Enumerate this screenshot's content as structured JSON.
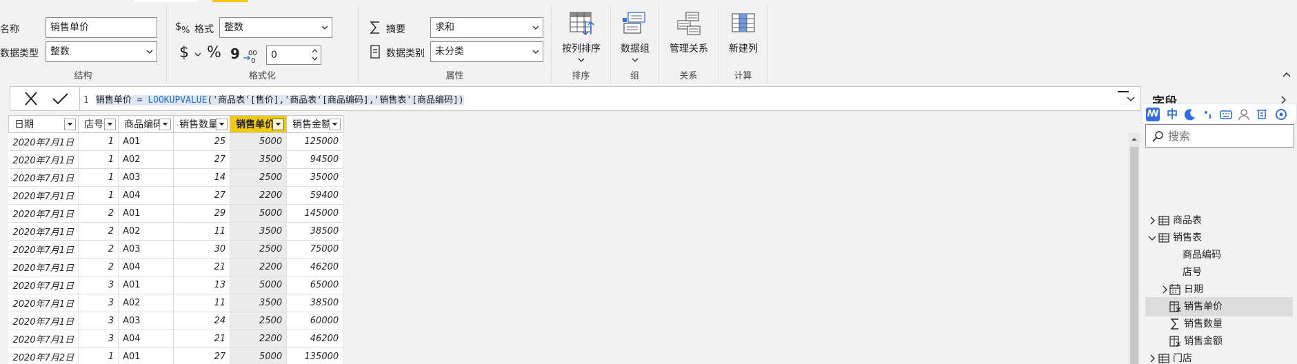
{
  "ribbon": {
    "structure": {
      "name_label": "名称",
      "name_value": "销售单价",
      "datatype_label": "数据类型",
      "datatype_value": "整数",
      "group_label": "结构"
    },
    "formatting": {
      "format_label": "格式",
      "format_value": "整数",
      "currency_symbol": "$",
      "percent_symbol": "%",
      "comma_symbol": "9",
      "decimals_value": "0",
      "group_label": "格式化"
    },
    "properties": {
      "summary_label": "摘要",
      "summary_value": "求和",
      "category_label": "数据类别",
      "category_value": "未分类",
      "group_label": "属性"
    },
    "sort": {
      "button_label": "按列排序",
      "group_label": "排序"
    },
    "groups": {
      "button_label": "数据组",
      "group_label": "组"
    },
    "relationships": {
      "button_label": "管理关系",
      "group_label": "关系"
    },
    "calculations": {
      "button_label": "新建列",
      "group_label": "计算"
    }
  },
  "formula_bar": {
    "line_number": "1",
    "column_name": "销售单价",
    "equals": "=",
    "function": "LOOKUPVALUE",
    "args": "('商品表'[售价],'商品表'[商品编码],'销售表'[商品编码])"
  },
  "table": {
    "columns": [
      "日期",
      "店号",
      "商品编码",
      "销售数量",
      "销售单价",
      "销售金额"
    ],
    "selected_column": "销售单价",
    "rows": [
      [
        "2020年7月1日",
        "1",
        "A01",
        "25",
        "5000",
        "125000"
      ],
      [
        "2020年7月1日",
        "1",
        "A02",
        "27",
        "3500",
        "94500"
      ],
      [
        "2020年7月1日",
        "1",
        "A03",
        "14",
        "2500",
        "35000"
      ],
      [
        "2020年7月1日",
        "1",
        "A04",
        "27",
        "2200",
        "59400"
      ],
      [
        "2020年7月1日",
        "2",
        "A01",
        "29",
        "5000",
        "145000"
      ],
      [
        "2020年7月1日",
        "2",
        "A02",
        "11",
        "3500",
        "38500"
      ],
      [
        "2020年7月1日",
        "2",
        "A03",
        "30",
        "2500",
        "75000"
      ],
      [
        "2020年7月1日",
        "2",
        "A04",
        "21",
        "2200",
        "46200"
      ],
      [
        "2020年7月1日",
        "3",
        "A01",
        "13",
        "5000",
        "65000"
      ],
      [
        "2020年7月1日",
        "3",
        "A02",
        "11",
        "3500",
        "38500"
      ],
      [
        "2020年7月1日",
        "3",
        "A03",
        "24",
        "2500",
        "60000"
      ],
      [
        "2020年7月1日",
        "3",
        "A04",
        "21",
        "2200",
        "46200"
      ],
      [
        "2020年7月2日",
        "1",
        "A01",
        "27",
        "5000",
        "135000"
      ]
    ]
  },
  "fields_pane": {
    "title": "字段",
    "ime_chars": [
      "中"
    ],
    "search_placeholder": "搜索",
    "items": [
      {
        "label": "商品表",
        "kind": "table",
        "expanded": false,
        "level": 0
      },
      {
        "label": "销售表",
        "kind": "table",
        "expanded": true,
        "level": 0
      },
      {
        "label": "商品编码",
        "kind": "field",
        "level": 1
      },
      {
        "label": "店号",
        "kind": "field",
        "level": 1
      },
      {
        "label": "日期",
        "kind": "date",
        "expanded": false,
        "level": 1
      },
      {
        "label": "销售单价",
        "kind": "calc-column",
        "level": 1,
        "selected": true
      },
      {
        "label": "销售数量",
        "kind": "sum",
        "level": 1
      },
      {
        "label": "销售金额",
        "kind": "calc-column",
        "level": 1
      },
      {
        "label": "门店",
        "kind": "table",
        "expanded": false,
        "level": 0
      }
    ]
  },
  "colors": {
    "accent_yellow": "#f2c811",
    "selected_column_bg": "#ebebeb",
    "ime_blue": "#2f6fe0",
    "formula_function": "#1f6fbf"
  }
}
